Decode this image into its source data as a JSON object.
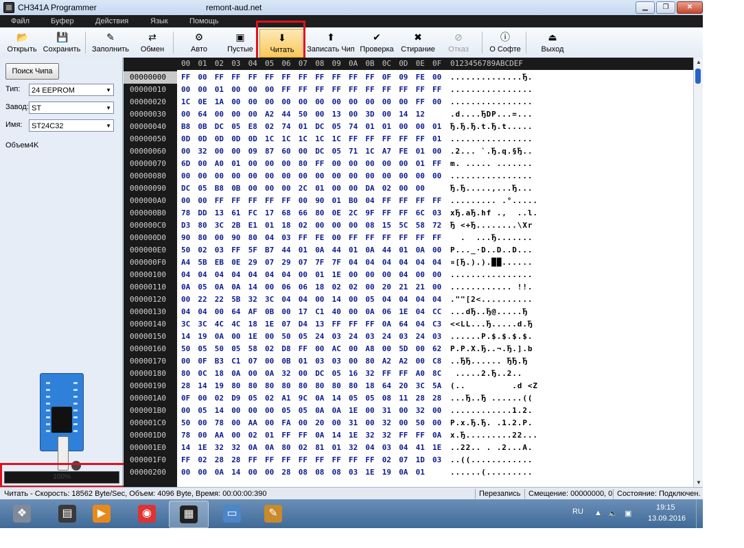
{
  "window": {
    "title": "CH341A Programmer",
    "site": "remont-aud.net",
    "minimize": "0",
    "maximize": "1",
    "close": "r"
  },
  "menu": [
    "Файл",
    "Буфер",
    "Действия",
    "Язык",
    "Помощь"
  ],
  "toolbar": [
    {
      "label": "Открыть",
      "icon": "folder-open-icon",
      "glyph": "📂"
    },
    {
      "label": "Сохранить",
      "icon": "floppy-disk-icon",
      "glyph": "💾"
    },
    {
      "label": "Заполнить",
      "icon": "fill-icon",
      "glyph": "✎"
    },
    {
      "label": "Обмен",
      "icon": "swap-arrows-icon",
      "glyph": "⇄"
    },
    {
      "label": "Авто",
      "icon": "auto-icon",
      "glyph": "⚙"
    },
    {
      "label": "Пустые",
      "icon": "blank-check-icon",
      "glyph": "▣"
    },
    {
      "label": "Читать",
      "icon": "read-chip-icon",
      "glyph": "⬇"
    },
    {
      "label": "Записать Чип",
      "icon": "write-chip-icon",
      "glyph": "⬆"
    },
    {
      "label": "Проверка",
      "icon": "verify-icon",
      "glyph": "✔"
    },
    {
      "label": "Стирание",
      "icon": "erase-icon",
      "glyph": "✖"
    },
    {
      "label": "Отказ",
      "icon": "cancel-icon",
      "glyph": "⊘"
    },
    {
      "label": "О Софте",
      "icon": "info-icon",
      "glyph": "ⓘ"
    },
    {
      "label": "Выход",
      "icon": "exit-icon",
      "glyph": "⏏"
    }
  ],
  "left": {
    "find_chip": "Поиск Чипа",
    "type_label": "Тип:",
    "type_value": "24 EEPROM",
    "maker_label": "Завод:",
    "maker_value": "ST",
    "name_label": "Имя:",
    "name_value": "ST24C32",
    "volume": "Объем4K",
    "progress_text": "100%",
    "progress_value": 1.0
  },
  "hex": {
    "columns": [
      "00",
      "01",
      "02",
      "03",
      "04",
      "05",
      "06",
      "07",
      "08",
      "09",
      "0A",
      "0B",
      "0C",
      "0D",
      "0E",
      "0F"
    ],
    "ascii_header": "0123456789ABCDEF",
    "rows": [
      {
        "addr": "00000000",
        "bytes": [
          "FF",
          "00",
          "FF",
          "FF",
          "FF",
          "FF",
          "FF",
          "FF",
          "FF",
          "FF",
          "FF",
          "FF",
          "0F",
          "09",
          "FE",
          "00"
        ],
        "ascii": "..............Ђ."
      },
      {
        "addr": "00000010",
        "bytes": [
          "00",
          "00",
          "01",
          "00",
          "00",
          "00",
          "FF",
          "FF",
          "FF",
          "FF",
          "FF",
          "FF",
          "FF",
          "FF",
          "FF",
          "FF"
        ],
        "ascii": "................"
      },
      {
        "addr": "00000020",
        "bytes": [
          "1C",
          "0E",
          "1A",
          "00",
          "00",
          "00",
          "00",
          "00",
          "00",
          "00",
          "00",
          "00",
          "00",
          "00",
          "FF",
          "00"
        ],
        "ascii": "................"
      },
      {
        "addr": "00000030",
        "bytes": [
          "00",
          "64",
          "00",
          "00",
          "00",
          "A2",
          "44",
          "50",
          "00",
          "13",
          "00",
          "3D",
          "00",
          "14",
          "12"
        ],
        "ascii": ".d....ЂDP...=..."
      },
      {
        "addr": "00000040",
        "bytes": [
          "B8",
          "0B",
          "DC",
          "05",
          "E8",
          "02",
          "74",
          "01",
          "DC",
          "05",
          "74",
          "01",
          "01",
          "00",
          "00",
          "01"
        ],
        "ascii": "Ђ.Ђ.Ђ.t.Ђ.t....."
      },
      {
        "addr": "00000050",
        "bytes": [
          "0D",
          "0D",
          "0D",
          "0D",
          "0D",
          "1C",
          "1C",
          "1C",
          "1C",
          "1C",
          "FF",
          "FF",
          "FF",
          "FF",
          "FF",
          "01"
        ],
        "ascii": "................"
      },
      {
        "addr": "00000060",
        "bytes": [
          "00",
          "32",
          "00",
          "00",
          "09",
          "87",
          "60",
          "00",
          "DC",
          "05",
          "71",
          "1C",
          "A7",
          "FE",
          "01",
          "00"
        ],
        "ascii": ".2... `.Ђ.q.§Ђ.."
      },
      {
        "addr": "00000070",
        "bytes": [
          "6D",
          "00",
          "A0",
          "01",
          "00",
          "00",
          "00",
          "80",
          "FF",
          "00",
          "00",
          "00",
          "00",
          "00",
          "01",
          "FF"
        ],
        "ascii": "m. ..... ......."
      },
      {
        "addr": "00000080",
        "bytes": [
          "00",
          "00",
          "00",
          "00",
          "00",
          "00",
          "00",
          "00",
          "00",
          "00",
          "00",
          "00",
          "00",
          "00",
          "00",
          "00"
        ],
        "ascii": "................"
      },
      {
        "addr": "00000090",
        "bytes": [
          "DC",
          "05",
          "B8",
          "0B",
          "00",
          "00",
          "00",
          "2C",
          "01",
          "00",
          "00",
          "DA",
          "02",
          "00",
          "00"
        ],
        "ascii": "Ђ.Ђ.....,...Ђ..."
      },
      {
        "addr": "000000A0",
        "bytes": [
          "00",
          "00",
          "FF",
          "FF",
          "FF",
          "FF",
          "FF",
          "00",
          "90",
          "01",
          "B0",
          "04",
          "FF",
          "FF",
          "FF",
          "FF"
        ],
        "ascii": "......... .°....."
      },
      {
        "addr": "000000B0",
        "bytes": [
          "78",
          "DD",
          "13",
          "61",
          "FC",
          "17",
          "68",
          "66",
          "80",
          "0E",
          "2C",
          "9F",
          "FF",
          "FF",
          "6C",
          "03"
        ],
        "ascii": "xЂ.aЂ.hf .,  ..l."
      },
      {
        "addr": "000000C0",
        "bytes": [
          "D3",
          "80",
          "3C",
          "2B",
          "E1",
          "01",
          "18",
          "02",
          "00",
          "00",
          "00",
          "08",
          "15",
          "5C",
          "58",
          "72"
        ],
        "ascii": "Ђ <+Ђ........\\Xr"
      },
      {
        "addr": "000000D0",
        "bytes": [
          "90",
          "80",
          "00",
          "90",
          "80",
          "04",
          "03",
          "FF",
          "FE",
          "00",
          "FF",
          "FF",
          "FF",
          "FF",
          "FF",
          "FF"
        ],
        "ascii": "  .  ...Ђ......."
      },
      {
        "addr": "000000E0",
        "bytes": [
          "50",
          "02",
          "03",
          "FF",
          "5F",
          "B7",
          "44",
          "01",
          "0A",
          "44",
          "01",
          "0A",
          "44",
          "01",
          "0A",
          "00"
        ],
        "ascii": "P..._·D..D..D..."
      },
      {
        "addr": "000000F0",
        "bytes": [
          "A4",
          "5B",
          "EB",
          "0E",
          "29",
          "07",
          "29",
          "07",
          "7F",
          "7F",
          "04",
          "04",
          "04",
          "04",
          "04",
          "04"
        ],
        "ascii": "¤[Ђ.).).██......"
      },
      {
        "addr": "00000100",
        "bytes": [
          "04",
          "04",
          "04",
          "04",
          "04",
          "04",
          "04",
          "00",
          "01",
          "1E",
          "00",
          "00",
          "00",
          "04",
          "00",
          "00"
        ],
        "ascii": "................"
      },
      {
        "addr": "00000110",
        "bytes": [
          "0A",
          "05",
          "0A",
          "0A",
          "14",
          "00",
          "06",
          "06",
          "18",
          "02",
          "02",
          "00",
          "20",
          "21",
          "21",
          "00"
        ],
        "ascii": "............ !!."
      },
      {
        "addr": "00000120",
        "bytes": [
          "00",
          "22",
          "22",
          "5B",
          "32",
          "3C",
          "04",
          "04",
          "00",
          "14",
          "00",
          "05",
          "04",
          "04",
          "04",
          "04"
        ],
        "ascii": ".\"\"[2<.........."
      },
      {
        "addr": "00000130",
        "bytes": [
          "04",
          "04",
          "00",
          "64",
          "AF",
          "0B",
          "00",
          "17",
          "C1",
          "40",
          "00",
          "0A",
          "06",
          "1E",
          "04",
          "CC"
        ],
        "ascii": "...dЂ..Ђ@.....Ђ"
      },
      {
        "addr": "00000140",
        "bytes": [
          "3C",
          "3C",
          "4C",
          "4C",
          "18",
          "1E",
          "07",
          "D4",
          "13",
          "FF",
          "FF",
          "FF",
          "0A",
          "64",
          "04",
          "C3"
        ],
        "ascii": "<<LL...Ђ.....d.Ђ"
      },
      {
        "addr": "00000150",
        "bytes": [
          "14",
          "19",
          "0A",
          "00",
          "1E",
          "00",
          "50",
          "05",
          "24",
          "03",
          "24",
          "03",
          "24",
          "03",
          "24",
          "03"
        ],
        "ascii": "......P.$.$.$.$."
      },
      {
        "addr": "00000160",
        "bytes": [
          "50",
          "05",
          "50",
          "05",
          "58",
          "02",
          "D8",
          "FF",
          "00",
          "AC",
          "00",
          "A8",
          "00",
          "5D",
          "00",
          "62"
        ],
        "ascii": "P.P.X.Ђ..¬.Ђ.].b"
      },
      {
        "addr": "00000170",
        "bytes": [
          "00",
          "0F",
          "B3",
          "C1",
          "07",
          "00",
          "0B",
          "01",
          "03",
          "03",
          "00",
          "80",
          "A2",
          "A2",
          "00",
          "C8"
        ],
        "ascii": "..ЂЂ...... ЂЂ.Ђ"
      },
      {
        "addr": "00000180",
        "bytes": [
          "80",
          "0C",
          "18",
          "0A",
          "00",
          "0A",
          "32",
          "00",
          "DC",
          "05",
          "16",
          "32",
          "FF",
          "FF",
          "A0",
          "8C"
        ],
        "ascii": " .....2.Ђ..2.. "
      },
      {
        "addr": "00000190",
        "bytes": [
          "28",
          "14",
          "19",
          "80",
          "80",
          "80",
          "80",
          "80",
          "80",
          "80",
          "80",
          "18",
          "64",
          "20",
          "3C",
          "5A"
        ],
        "ascii": "(..         .d <Z"
      },
      {
        "addr": "000001A0",
        "bytes": [
          "0F",
          "00",
          "02",
          "D9",
          "05",
          "02",
          "A1",
          "9C",
          "0A",
          "14",
          "05",
          "05",
          "08",
          "11",
          "28",
          "28"
        ],
        "ascii": "...Ђ..Ђ ......(("
      },
      {
        "addr": "000001B0",
        "bytes": [
          "00",
          "05",
          "14",
          "00",
          "00",
          "00",
          "05",
          "05",
          "0A",
          "0A",
          "1E",
          "00",
          "31",
          "00",
          "32",
          "00"
        ],
        "ascii": "............1.2."
      },
      {
        "addr": "000001C0",
        "bytes": [
          "50",
          "00",
          "78",
          "00",
          "AA",
          "00",
          "FA",
          "00",
          "20",
          "00",
          "31",
          "00",
          "32",
          "00",
          "50",
          "00"
        ],
        "ascii": "P.x.Ђ.Ђ. .1.2.P."
      },
      {
        "addr": "000001D0",
        "bytes": [
          "78",
          "00",
          "AA",
          "00",
          "02",
          "01",
          "FF",
          "FF",
          "0A",
          "14",
          "1E",
          "32",
          "32",
          "FF",
          "FF",
          "0A"
        ],
        "ascii": "x.Ђ.........22..."
      },
      {
        "addr": "000001E0",
        "bytes": [
          "14",
          "1E",
          "32",
          "32",
          "0A",
          "0A",
          "80",
          "02",
          "81",
          "01",
          "32",
          "04",
          "03",
          "04",
          "41",
          "1E"
        ],
        "ascii": "..22.. . .2...A."
      },
      {
        "addr": "000001F0",
        "bytes": [
          "FF",
          "02",
          "28",
          "28",
          "FF",
          "FF",
          "FF",
          "FF",
          "FF",
          "FF",
          "FF",
          "FF",
          "02",
          "07",
          "1D",
          "03",
          "1E"
        ],
        "ascii": "..((............"
      },
      {
        "addr": "00000200",
        "bytes": [
          "00",
          "00",
          "0A",
          "14",
          "00",
          "00",
          "28",
          "08",
          "08",
          "08",
          "03",
          "1E",
          "19",
          "0A",
          "01"
        ],
        "ascii": "......(........."
      }
    ]
  },
  "status": {
    "left": "Читать - Скорость: 18562 Byte/Sec, Объем: 4096 Byte, Время: 00:00:00:390",
    "mode": "Перезапись",
    "offset": "Смещение: 00000000, 0",
    "state": "Состояние: Подключен."
  },
  "taskbar": {
    "apps": [
      {
        "name": "start-button",
        "glyph": "❖"
      },
      {
        "name": "toolbox-app",
        "glyph": "▤"
      },
      {
        "name": "media-player-app",
        "glyph": "▶"
      },
      {
        "name": "chrome-app",
        "glyph": "◉"
      },
      {
        "name": "ch341a-app",
        "glyph": "▦"
      },
      {
        "name": "picture-viewer-app",
        "glyph": "▭"
      },
      {
        "name": "paint-app",
        "glyph": "✎"
      }
    ],
    "lang": "RU",
    "time": "19:15",
    "date": "13.09.2016"
  }
}
